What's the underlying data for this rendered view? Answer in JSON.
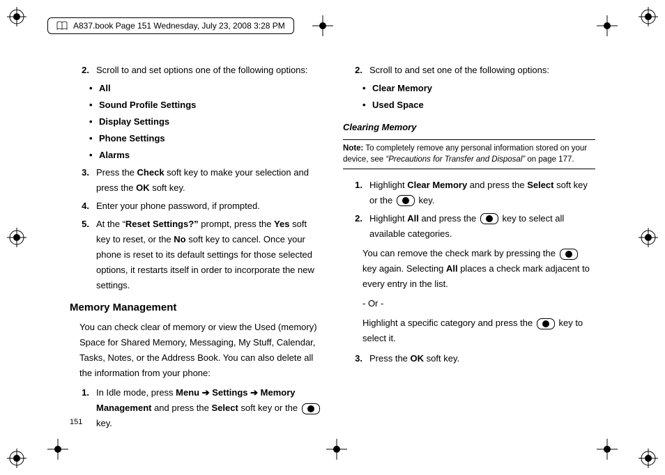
{
  "header": {
    "text": "A837.book  Page 151  Wednesday, July 23, 2008  3:28 PM"
  },
  "page_number": "151",
  "left": {
    "step2": "Scroll to and set options one of the following options:",
    "bullets": [
      "All",
      "Sound Profile Settings",
      "Display Settings",
      "Phone Settings",
      "Alarms"
    ],
    "step3_a": "Press the ",
    "step3_b": "Check",
    "step3_c": " soft key to make your selection and press the ",
    "step3_d": "OK",
    "step3_e": " soft key.",
    "step4": "Enter your phone password, if prompted.",
    "step5_a": "At the “",
    "step5_b": "Reset Settings?”",
    "step5_c": " prompt, press the ",
    "step5_d": "Yes",
    "step5_e": " soft key to reset, or the ",
    "step5_f": "No",
    "step5_g": " soft key to cancel. Once your phone is reset to its default settings for those selected options, it restarts itself in order to incorporate the new settings.",
    "section": "Memory Management",
    "section_para": "You can check clear of memory or view the Used (memory) Space for Shared Memory, Messaging, My Stuff, Calendar, Tasks, Notes, or the Address Book. You can also delete all the information from your phone:",
    "mm_step1_a": "In Idle mode, press ",
    "mm_step1_b": "Menu",
    "mm_step1_c": "Settings",
    "mm_step1_d": "Memory Management",
    "mm_step1_e": " and press the ",
    "mm_step1_f": "Select",
    "mm_step1_g": " soft key or the ",
    "mm_step1_h": " key."
  },
  "right": {
    "step2": "Scroll to and set one of the following options:",
    "bullets": [
      "Clear Memory",
      "Used Space"
    ],
    "sub": "Clearing Memory",
    "note_label": "Note:",
    "note_a": " To completely remove any personal information stored on your device, see ",
    "note_b": "“Precautions for Transfer and Disposal”",
    "note_c": " on page 177.",
    "cm1_a": "Highlight ",
    "cm1_b": "Clear Memory",
    "cm1_c": " and press the ",
    "cm1_d": "Select",
    "cm1_e": " soft key or the ",
    "cm1_f": " key.",
    "cm2_a": "Highlight ",
    "cm2_b": "All",
    "cm2_c": " and press the ",
    "cm2_d": " key to select all available categories.",
    "cm2_p2_a": "You can remove the check mark by pressing the ",
    "cm2_p2_b": " key again. Selecting ",
    "cm2_p2_c": "All",
    "cm2_p2_d": " places a check mark adjacent to every entry in the list.",
    "or": "- Or -",
    "cm2_p3_a": "Highlight a specific category and press the ",
    "cm2_p3_b": " key to select it.",
    "cm3_a": "Press the ",
    "cm3_b": "OK",
    "cm3_c": " soft key."
  }
}
